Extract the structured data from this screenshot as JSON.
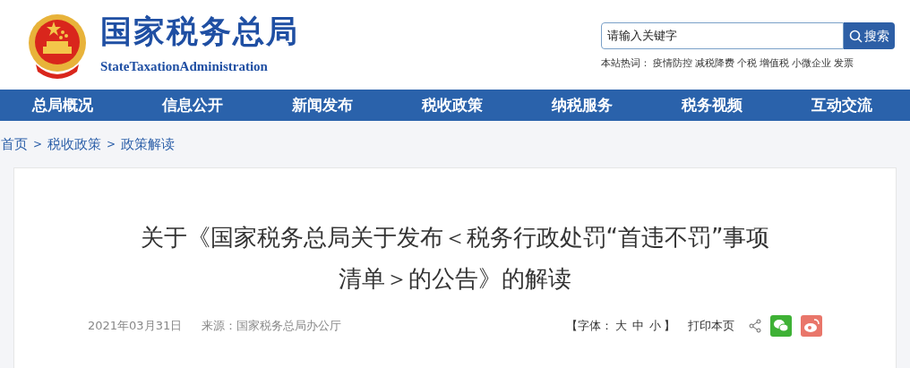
{
  "header": {
    "title": "国家税务总局",
    "subtitle": "StateTaxationAdministration",
    "search": {
      "placeholder": "请输入关键字",
      "button": "搜索"
    },
    "hot_words": {
      "label": "本站热词：",
      "items": [
        "疫情防控",
        "减税降费",
        "个税",
        "增值税",
        "小微企业",
        "发票"
      ]
    }
  },
  "nav": [
    "总局概况",
    "信息公开",
    "新闻发布",
    "税收政策",
    "纳税服务",
    "税务视频",
    "互动交流"
  ],
  "breadcrumb": [
    "首页",
    "税收政策",
    "政策解读"
  ],
  "breadcrumb_separator": ">",
  "article": {
    "title_lines": [
      "关于《国家税务总局关于发布＜税务行政处罚“首违不罚”事项",
      "清单＞的公告》的解读"
    ],
    "date": "2021年03月31日",
    "source": "来源：国家税务总局办公厅",
    "font_label_open": "【字体：",
    "font_sizes": [
      "大",
      "中",
      "小"
    ],
    "font_label_close": "】",
    "print": "打印本页"
  }
}
